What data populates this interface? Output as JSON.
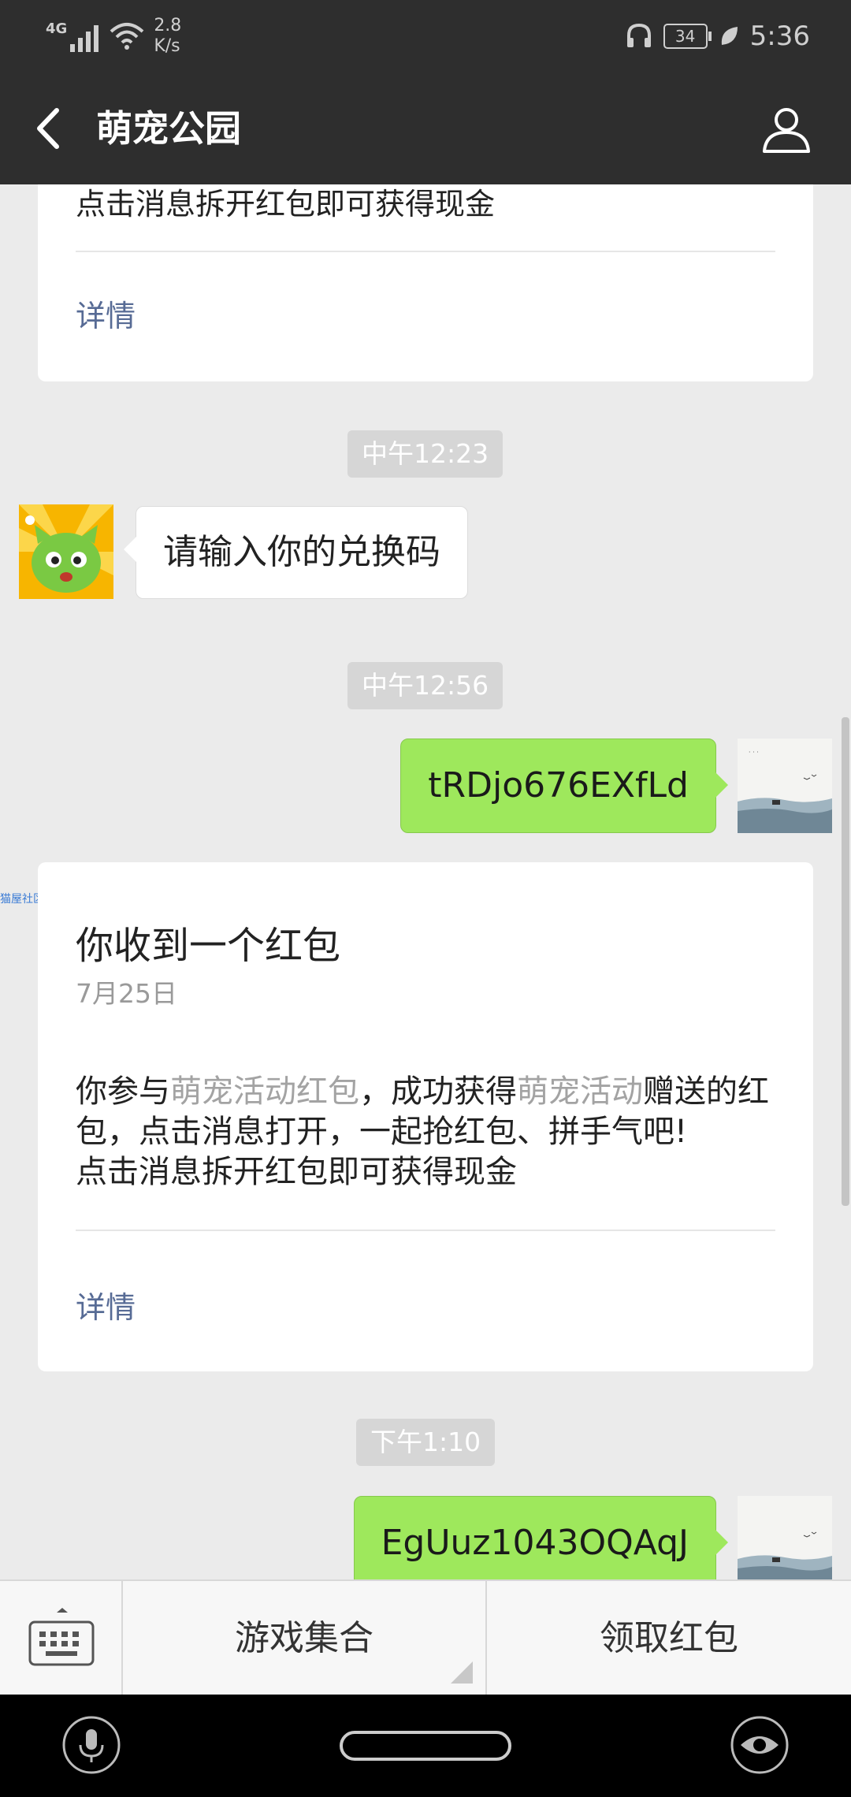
{
  "status_bar": {
    "network": "4G",
    "speed_value": "2.8",
    "speed_unit": "K/s",
    "battery": "34",
    "time": "5:36"
  },
  "header": {
    "title": "萌宠公园",
    "back_icon": "chevron-left-icon",
    "profile_icon": "person-icon"
  },
  "messages": {
    "card1": {
      "partial_line": "点击消息拆开红包即可获得现金",
      "detail_label": "详情"
    },
    "time1": "中午12:23",
    "incoming1": "请输入你的兑换码",
    "time2": "中午12:56",
    "outgoing1": "tRDjo676EXfLd",
    "card2": {
      "title": "你收到一个红包",
      "date": "7月25日",
      "body_part1": "你参与",
      "body_highlight1": "萌宠活动红包",
      "body_part2": "，成功获得",
      "body_highlight2": "萌宠活动",
      "body_part3": "赠送的红包，点击消息打开，一起抢红包、拼手气吧!",
      "body_line3": "点击消息拆开红包即可获得现金",
      "detail_label": "详情"
    },
    "time3": "下午1:10",
    "outgoing2": "EgUuz1043OQAqJ"
  },
  "side_text": "猫屋社区",
  "bottom_menu": {
    "keyboard_icon": "keyboard-icon",
    "item1": "游戏集合",
    "item2": "领取红包"
  },
  "nav_bar": {
    "mic_icon": "microphone-icon",
    "home_icon": "home-pill-icon",
    "eye_icon": "eye-icon"
  },
  "colors": {
    "header_bg": "#2e2e2e",
    "chat_bg": "#ebebeb",
    "outgoing_bubble": "#9ee85c",
    "link": "#576b95"
  }
}
